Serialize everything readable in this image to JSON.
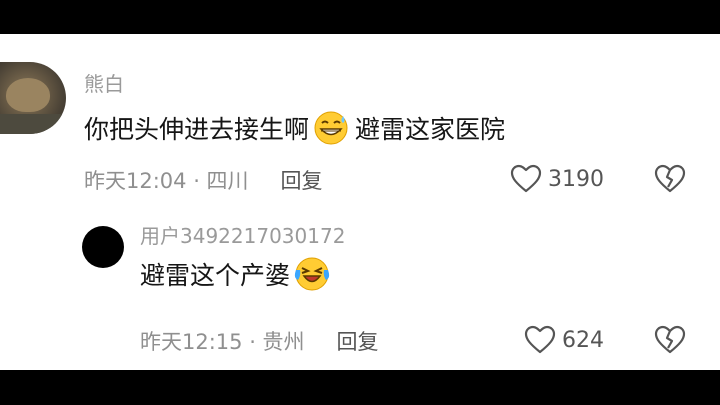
{
  "comments": [
    {
      "username": "熊白",
      "text_before": "你把头伸进去接生啊",
      "emoji": "grinning-sweat-emoji",
      "text_after": "避雷这家医院",
      "meta": "昨天12:04 · 四川",
      "reply_label": "回复",
      "likes": "3190"
    },
    {
      "username": "用户3492217030172",
      "text_before": "避雷这个产婆",
      "emoji": "crying-laughing-emoji",
      "text_after": "",
      "meta": "昨天12:15 · 贵州",
      "reply_label": "回复",
      "likes": "624"
    }
  ],
  "colors": {
    "letterbox": "#000000",
    "background": "#ffffff",
    "username": "#9a9a9a",
    "text": "#161616",
    "meta": "#8f8f8f",
    "icon": "#555555",
    "emoji_face": "#ffcc33"
  }
}
